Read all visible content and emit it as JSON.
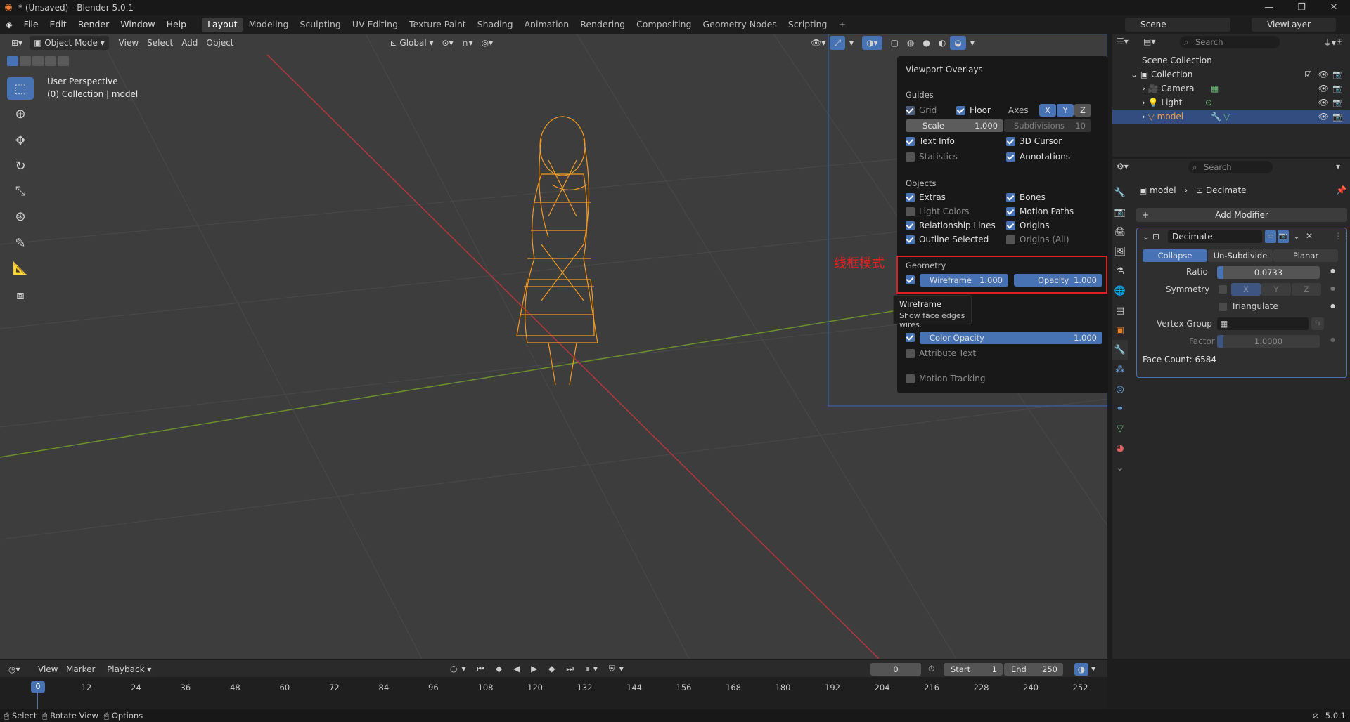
{
  "window": {
    "title": "* (Unsaved) - Blender 5.0.1",
    "controls": [
      "—",
      "❐",
      "✕"
    ]
  },
  "menus": [
    "File",
    "Edit",
    "Render",
    "Window",
    "Help"
  ],
  "workspaces": [
    "Layout",
    "Modeling",
    "Sculpting",
    "UV Editing",
    "Texture Paint",
    "Shading",
    "Animation",
    "Rendering",
    "Compositing",
    "Geometry Nodes",
    "Scripting",
    "+"
  ],
  "scene": {
    "scene_name": "Scene",
    "view_layer": "ViewLayer"
  },
  "viewport_header": {
    "mode": "Object Mode",
    "menus": [
      "View",
      "Select",
      "Add",
      "Object"
    ],
    "transform_orientation": "Global"
  },
  "viewport_info": {
    "perspective": "User Perspective",
    "collection": "(0) Collection | model"
  },
  "annotation": {
    "text": "线框模式",
    "color": "#e82020"
  },
  "overlays": {
    "title": "Viewport Overlays",
    "guides": {
      "heading": "Guides",
      "grid": "Grid",
      "floor": "Floor",
      "axes": "Axes",
      "x": "X",
      "y": "Y",
      "z": "Z",
      "scale_label": "Scale",
      "scale_value": "1.000",
      "subdivisions_label": "Subdivisions",
      "subdivisions_value": "10",
      "text_info": "Text Info",
      "cursor": "3D Cursor",
      "statistics": "Statistics",
      "annotations": "Annotations"
    },
    "objects": {
      "heading": "Objects",
      "extras": "Extras",
      "bones": "Bones",
      "light_colors": "Light Colors",
      "motion_paths": "Motion Paths",
      "relationship_lines": "Relationship Lines",
      "origins": "Origins",
      "outline_selected": "Outline Selected",
      "origins_all": "Origins (All)"
    },
    "geometry": {
      "heading": "Geometry",
      "wireframe_label": "Wireframe",
      "wireframe_value": "1.000",
      "opacity_label": "Opacity",
      "opacity_value": "1.000",
      "color_opacity_label": "Color Opacity",
      "color_opacity_value": "1.000",
      "attribute_text": "Attribute Text",
      "motion_tracking": "Motion Tracking"
    },
    "tooltip": {
      "title": "Wireframe",
      "desc": "Show face edges wires."
    }
  },
  "outliner": {
    "search_placeholder": "Search",
    "rows": [
      {
        "label": "Scene Collection"
      },
      {
        "label": "Collection"
      },
      {
        "label": "Camera"
      },
      {
        "label": "Light"
      },
      {
        "label": "model"
      }
    ]
  },
  "properties": {
    "search_placeholder": "Search",
    "breadcrumb_object": "model",
    "breadcrumb_modifier": "Decimate",
    "add_modifier": "Add Modifier",
    "modifier_name": "Decimate",
    "modes": [
      "Collapse",
      "Un-Subdivide",
      "Planar"
    ],
    "ratio_label": "Ratio",
    "ratio_value": "0.0733",
    "symmetry_label": "Symmetry",
    "sym_x": "X",
    "sym_y": "Y",
    "sym_z": "Z",
    "triangulate": "Triangulate",
    "vertex_group_label": "Vertex Group",
    "factor_label": "Factor",
    "factor_value": "1.0000",
    "face_count": "Face Count: 6584"
  },
  "timeline": {
    "menus": [
      "View",
      "Marker",
      "Playback"
    ],
    "current_frame": "0",
    "start_label": "Start",
    "start_value": "1",
    "end_label": "End",
    "end_value": "250",
    "ticks": [
      "0",
      "12",
      "24",
      "36",
      "48",
      "60",
      "72",
      "84",
      "96",
      "108",
      "120",
      "132",
      "144",
      "156",
      "168",
      "180",
      "192",
      "204",
      "216",
      "228",
      "240",
      "252"
    ]
  },
  "statusbar": {
    "select": "Select",
    "rotate": "Rotate View",
    "options": "Options",
    "version": "5.0.1"
  }
}
